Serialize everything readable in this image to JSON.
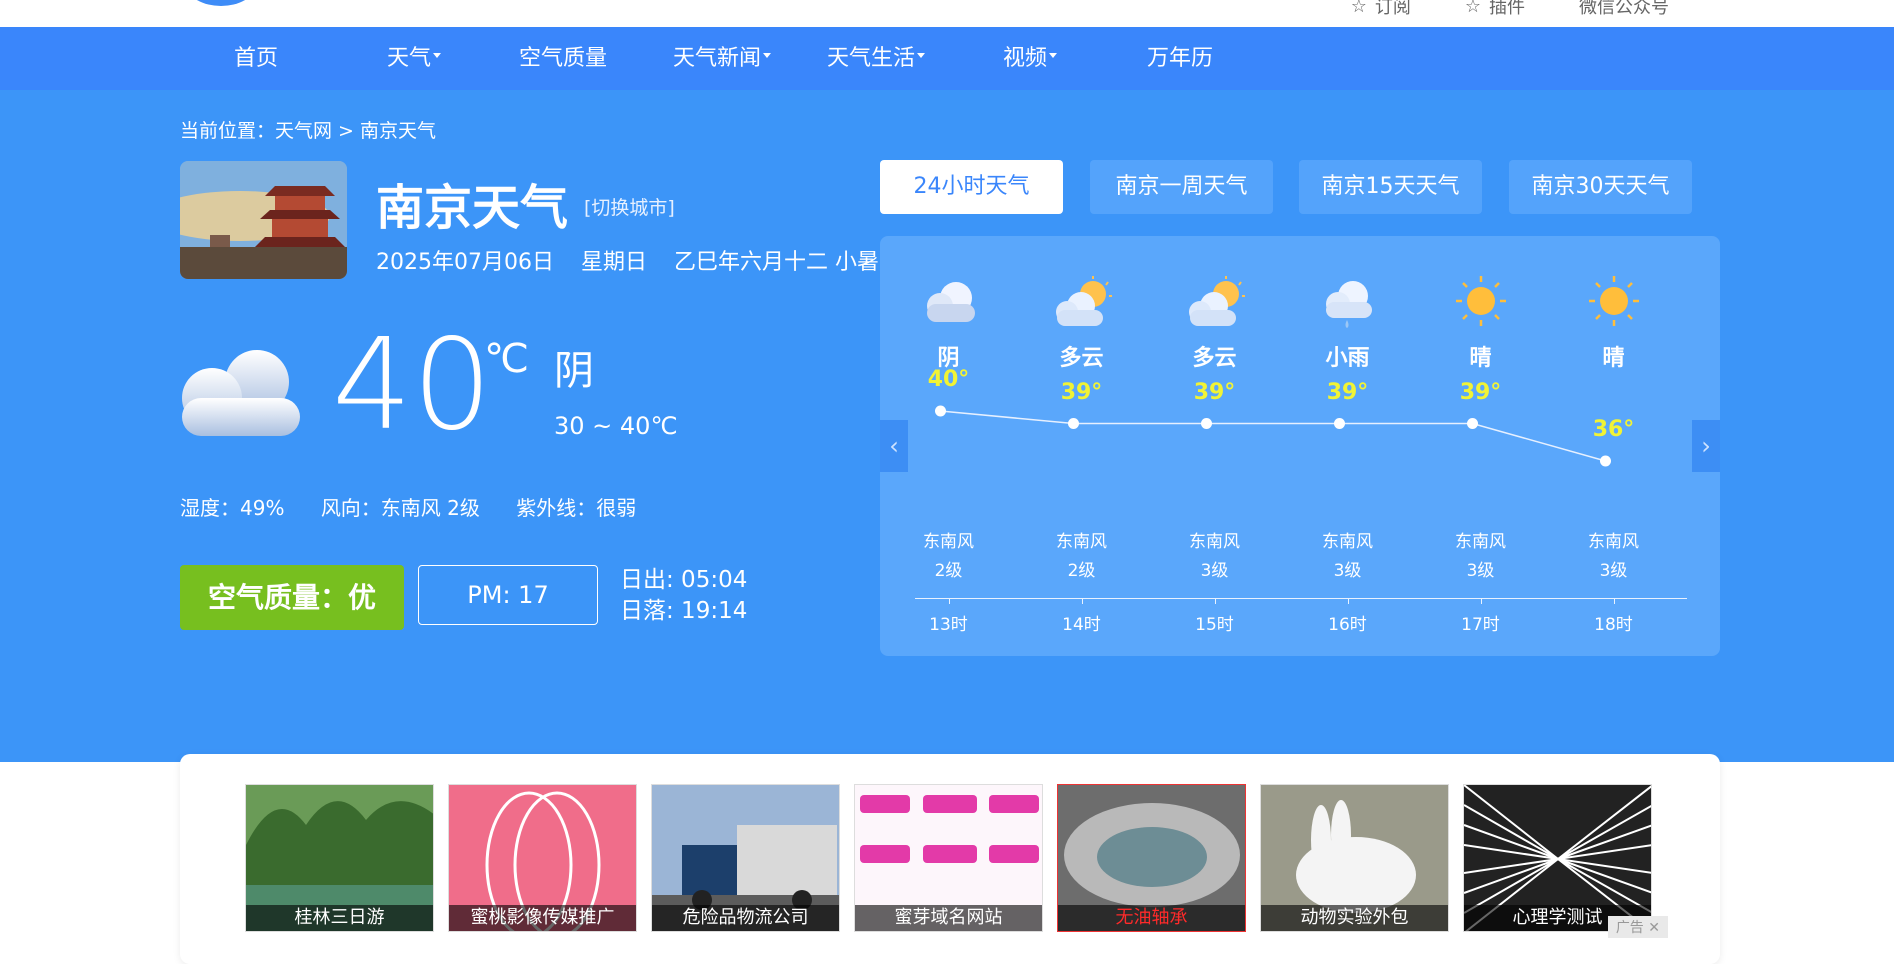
{
  "top_bar": {
    "links": [
      "订阅",
      "插件",
      "微信公众号"
    ]
  },
  "nav": {
    "items": [
      {
        "label": "首页",
        "dropdown": false
      },
      {
        "label": "天气",
        "dropdown": true
      },
      {
        "label": "空气质量",
        "dropdown": false
      },
      {
        "label": "天气新闻",
        "dropdown": true
      },
      {
        "label": "天气生活",
        "dropdown": true
      },
      {
        "label": "视频",
        "dropdown": true
      },
      {
        "label": "万年历",
        "dropdown": false
      }
    ]
  },
  "breadcrumb": "当前位置：天气网 > 南京天气",
  "city": {
    "title": "南京天气",
    "switch_label": "[切换城市]",
    "date": "2025年07月06日",
    "weekday": "星期日",
    "lunar": "乙巳年六月十二 小暑"
  },
  "current": {
    "temp": "40",
    "unit": "℃",
    "condition": "阴",
    "range": "30 ~ 40℃",
    "humidity": "湿度：49%",
    "wind": "风向：东南风 2级",
    "uv": "紫外线：很弱",
    "aqi": "空气质量：优",
    "pm": "PM: 17",
    "sunrise": "日出: 05:04",
    "sunset": "日落: 19:14"
  },
  "tabs": [
    {
      "label": "24小时天气",
      "active": true
    },
    {
      "label": "南京一周天气",
      "active": false
    },
    {
      "label": "南京15天天气",
      "active": false
    },
    {
      "label": "南京30天天气",
      "active": false
    }
  ],
  "hourly": [
    {
      "icon": "cloud-icon",
      "condition": "阴",
      "temp": 40,
      "temp_label": "40°",
      "wind": "东南风",
      "level": "2级",
      "time": "13时"
    },
    {
      "icon": "partly-cloudy-icon",
      "condition": "多云",
      "temp": 39,
      "temp_label": "39°",
      "wind": "东南风",
      "level": "2级",
      "time": "14时"
    },
    {
      "icon": "partly-cloudy-icon",
      "condition": "多云",
      "temp": 39,
      "temp_label": "39°",
      "wind": "东南风",
      "level": "3级",
      "time": "15时"
    },
    {
      "icon": "rain-icon",
      "condition": "小雨",
      "temp": 39,
      "temp_label": "39°",
      "wind": "东南风",
      "level": "3级",
      "time": "16时"
    },
    {
      "icon": "sun-icon",
      "condition": "晴",
      "temp": 39,
      "temp_label": "39°",
      "wind": "东南风",
      "level": "3级",
      "time": "17时"
    },
    {
      "icon": "sun-icon",
      "condition": "晴",
      "temp": 36,
      "temp_label": "36°",
      "wind": "东南风",
      "level": "3级",
      "time": "18时"
    }
  ],
  "ads": [
    {
      "label": "桂林三日游",
      "highlight": false
    },
    {
      "label": "蜜桃影像传媒推广",
      "highlight": false
    },
    {
      "label": "危险品物流公司",
      "highlight": false
    },
    {
      "label": "蜜芽域名网站",
      "highlight": false
    },
    {
      "label": "无油轴承",
      "highlight": true
    },
    {
      "label": "动物实验外包",
      "highlight": false
    },
    {
      "label": "心理学测试",
      "highlight": false
    }
  ],
  "ad_badge": "广告 ✕",
  "colors": {
    "nav_bg": "#3a86fb",
    "hero_bg": "#3c95f8",
    "panel_bg": "#5aa7fb",
    "aqi_green": "#77bf1f",
    "temp_yellow": "#f1f335"
  }
}
